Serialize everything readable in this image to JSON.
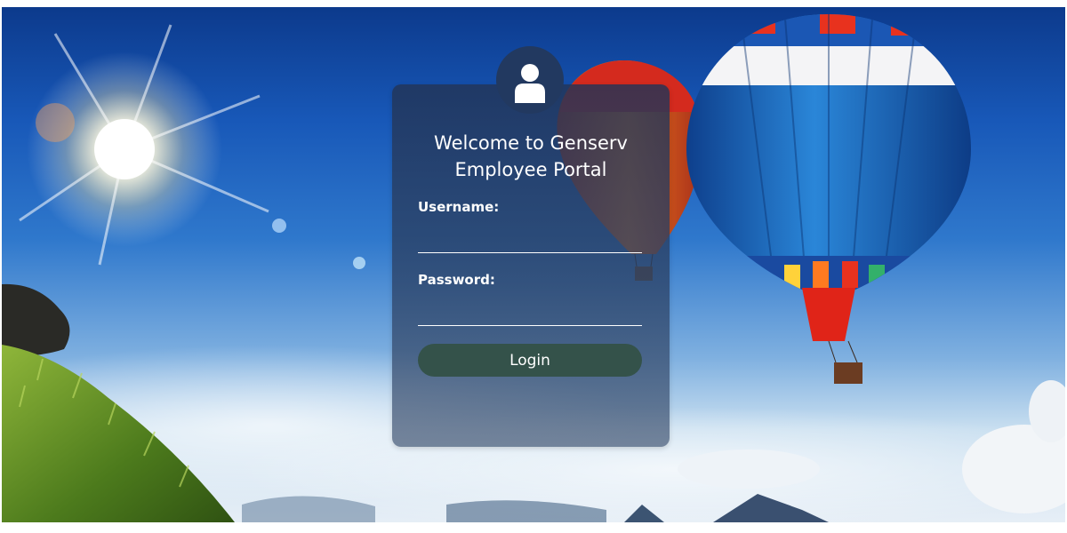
{
  "login": {
    "title_line1": "Welcome to Genserv",
    "title_line2": "Employee Portal",
    "username_label": "Username:",
    "username_value": "",
    "password_label": "Password:",
    "password_value": "",
    "login_button": "Login"
  },
  "icons": {
    "avatar": "user-icon"
  },
  "colors": {
    "card_background": "#2c4266",
    "avatar_badge": "#223960",
    "login_button": "#34524a",
    "text": "#ffffff"
  }
}
